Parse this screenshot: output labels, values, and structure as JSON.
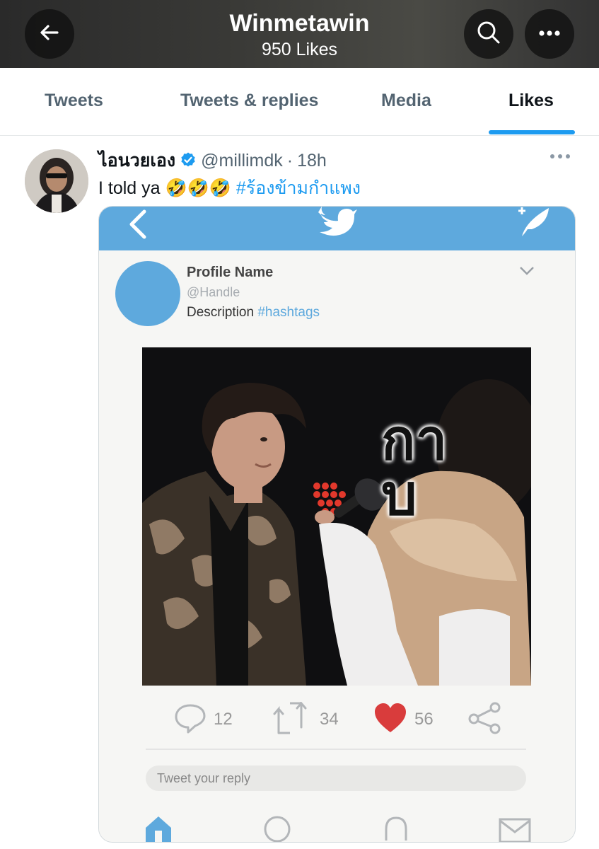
{
  "header": {
    "title": "Winmetawin",
    "subtitle": "950 Likes",
    "icons": [
      "back-arrow-icon",
      "search-icon",
      "more-icon"
    ],
    "background": "#3a3a37"
  },
  "tabs": [
    {
      "label": "Tweets",
      "active": false
    },
    {
      "label": "Tweets & replies",
      "active": false
    },
    {
      "label": "Media",
      "active": false
    },
    {
      "label": "Likes",
      "active": true
    }
  ],
  "tweet": {
    "author_name": "ไอนวยเอง",
    "handle": "@millimdk",
    "separator": "·",
    "time": "18h",
    "text": "I told ya",
    "emojis": "🤣🤣🤣",
    "hashtag": "#ร้องข้ามกำแพง"
  },
  "media": {
    "profile_name": "Profile Name",
    "handle": "@Handle",
    "description": "Description",
    "hashtag": "#hashtags",
    "sticker_text": "กาบ",
    "reply_count": "12",
    "retweet_count": "34",
    "like_count": "56",
    "reply_placeholder": "Tweet your reply",
    "accent": "#5ea9dd",
    "heart_color": "#d93c3c"
  },
  "colors": {
    "link": "#1d9bf0",
    "muted": "#536471",
    "text": "#0f1419"
  }
}
